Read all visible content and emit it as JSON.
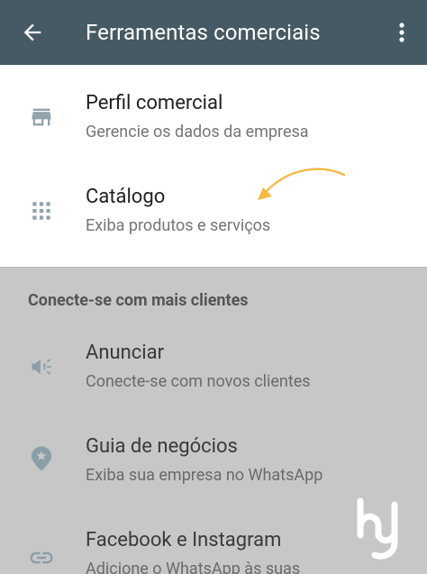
{
  "appbar": {
    "title": "Ferramentas comerciais",
    "back_icon": "arrow-left-icon",
    "more_icon": "more-vertical-icon",
    "background": "#455a64"
  },
  "top_items": [
    {
      "title": "Perfil comercial",
      "subtitle": "Gerencie os dados da empresa",
      "icon": "store-icon"
    },
    {
      "title": "Catálogo",
      "subtitle": "Exiba produtos e serviços",
      "icon": "grid-icon"
    }
  ],
  "annotation": {
    "icon": "curved-arrow-annotation",
    "color": "#f5b942"
  },
  "section": {
    "header": "Conecte-se com mais clientes",
    "items": [
      {
        "title": "Anunciar",
        "subtitle": "Conecte-se com novos clientes",
        "icon": "megaphone-icon"
      },
      {
        "title": "Guia de negócios",
        "subtitle": "Exiba sua empresa no WhatsApp",
        "icon": "map-pin-star-icon"
      },
      {
        "title": "Facebook e Instagram",
        "subtitle": "Adicione o WhatsApp às suas",
        "icon": "link-icon"
      }
    ]
  },
  "watermark": {
    "icon": "hj-watermark-logo"
  }
}
